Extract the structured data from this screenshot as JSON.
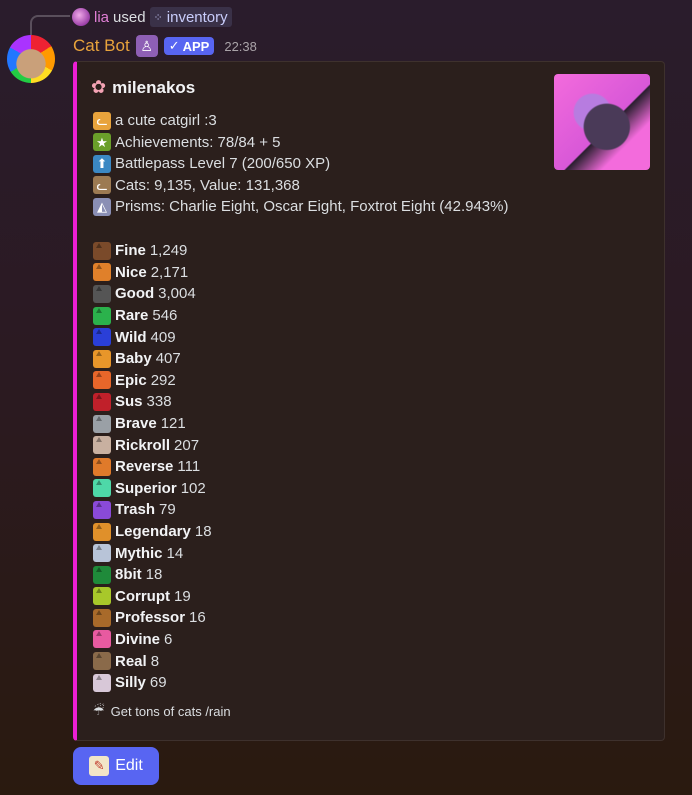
{
  "reply": {
    "user": "lia",
    "used": "used",
    "command": "inventory"
  },
  "message": {
    "author": "Cat Bot",
    "app_tag": "APP",
    "time": "22:38",
    "accent_color": "#ec1fd4"
  },
  "embed": {
    "title": "milenakos",
    "lines": [
      {
        "icon": "cat-face-icon",
        "color": "#e8a33c",
        "text": "a cute catgirl :3"
      },
      {
        "icon": "achievement-icon",
        "color": "#6a9f2a",
        "text": "Achievements: 78/84 + 5"
      },
      {
        "icon": "up-arrow-icon",
        "color": "#3b88c3",
        "text": "Battlepass Level 7 (200/650 XP)"
      },
      {
        "icon": "cat-icon",
        "color": "#9c7a52",
        "text": "Cats: 9,135, Value: 131,368"
      },
      {
        "icon": "prism-icon",
        "color": "#8a8fb5",
        "text": "Prisms: Charlie Eight, Oscar Eight, Foxtrot Eight (42.943%)"
      }
    ],
    "cats": [
      {
        "name": "Fine",
        "count": "1,249",
        "color": "#7a4a2a"
      },
      {
        "name": "Nice",
        "count": "2,171",
        "color": "#e0802a"
      },
      {
        "name": "Good",
        "count": "3,004",
        "color": "#555555"
      },
      {
        "name": "Rare",
        "count": "546",
        "color": "#2bb24c"
      },
      {
        "name": "Wild",
        "count": "409",
        "color": "#2a3fd8"
      },
      {
        "name": "Baby",
        "count": "407",
        "color": "#e8962a"
      },
      {
        "name": "Epic",
        "count": "292",
        "color": "#e8662a"
      },
      {
        "name": "Sus",
        "count": "338",
        "color": "#c0202a"
      },
      {
        "name": "Brave",
        "count": "121",
        "color": "#9aa0a6"
      },
      {
        "name": "Rickroll",
        "count": "207",
        "color": "#c8b0a0"
      },
      {
        "name": "Reverse",
        "count": "111",
        "color": "#e07a2a"
      },
      {
        "name": "Superior",
        "count": "102",
        "color": "#4ed8a8"
      },
      {
        "name": "Trash",
        "count": "79",
        "color": "#8a4ad8"
      },
      {
        "name": "Legendary",
        "count": "18",
        "color": "#e0902a"
      },
      {
        "name": "Mythic",
        "count": "14",
        "color": "#b8c4d8"
      },
      {
        "name": "8bit",
        "count": "18",
        "color": "#1f8a3a"
      },
      {
        "name": "Corrupt",
        "count": "19",
        "color": "#a8c82a"
      },
      {
        "name": "Professor",
        "count": "16",
        "color": "#a86a2a"
      },
      {
        "name": "Divine",
        "count": "6",
        "color": "#e85aa0"
      },
      {
        "name": "Real",
        "count": "8",
        "color": "#8a6a4a"
      },
      {
        "name": "Silly",
        "count": "69",
        "color": "#d8c8d8"
      }
    ],
    "footer": "Get tons of cats /rain"
  },
  "edit_button": {
    "label": "Edit"
  }
}
